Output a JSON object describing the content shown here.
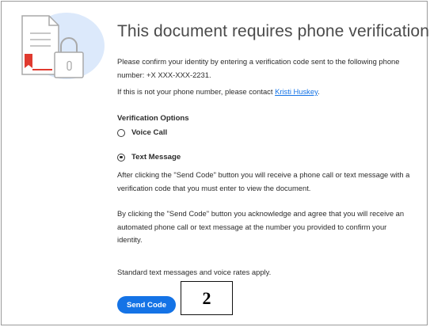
{
  "header": {
    "title": "This document requires phone verification"
  },
  "intro": {
    "confirm_text": "Please confirm your identity by entering a verification code sent to the following phone number: +X XXX-XXX-2231.",
    "contact_prefix": "If this is not your phone number, please contact ",
    "contact_name": "Kristi Huskey",
    "contact_suffix": "."
  },
  "verification": {
    "title": "Verification Options",
    "options": [
      {
        "label": "Voice Call",
        "selected": false
      },
      {
        "label": "Text Message",
        "selected": true
      }
    ],
    "selected": "Text Message"
  },
  "details": {
    "after_click_text": "After clicking the \"Send Code\" button you will receive a phone call or text message with a verification code that you must enter to view the document.",
    "acknowledge_text": "By clicking the \"Send Code\" button you acknowledge and agree that you will receive an automated phone call or text message at the number you provided to confirm your identity.",
    "rates_text": "Standard text messages and voice rates apply."
  },
  "actions": {
    "send_code_label": "Send Code"
  },
  "annotation": {
    "step_label": "2"
  },
  "colors": {
    "accent": "#1473e6",
    "illustration_bg": "#dce9fb",
    "illustration_red": "#e03a2f"
  },
  "icons": {
    "illustration": "document-lock-icon"
  }
}
